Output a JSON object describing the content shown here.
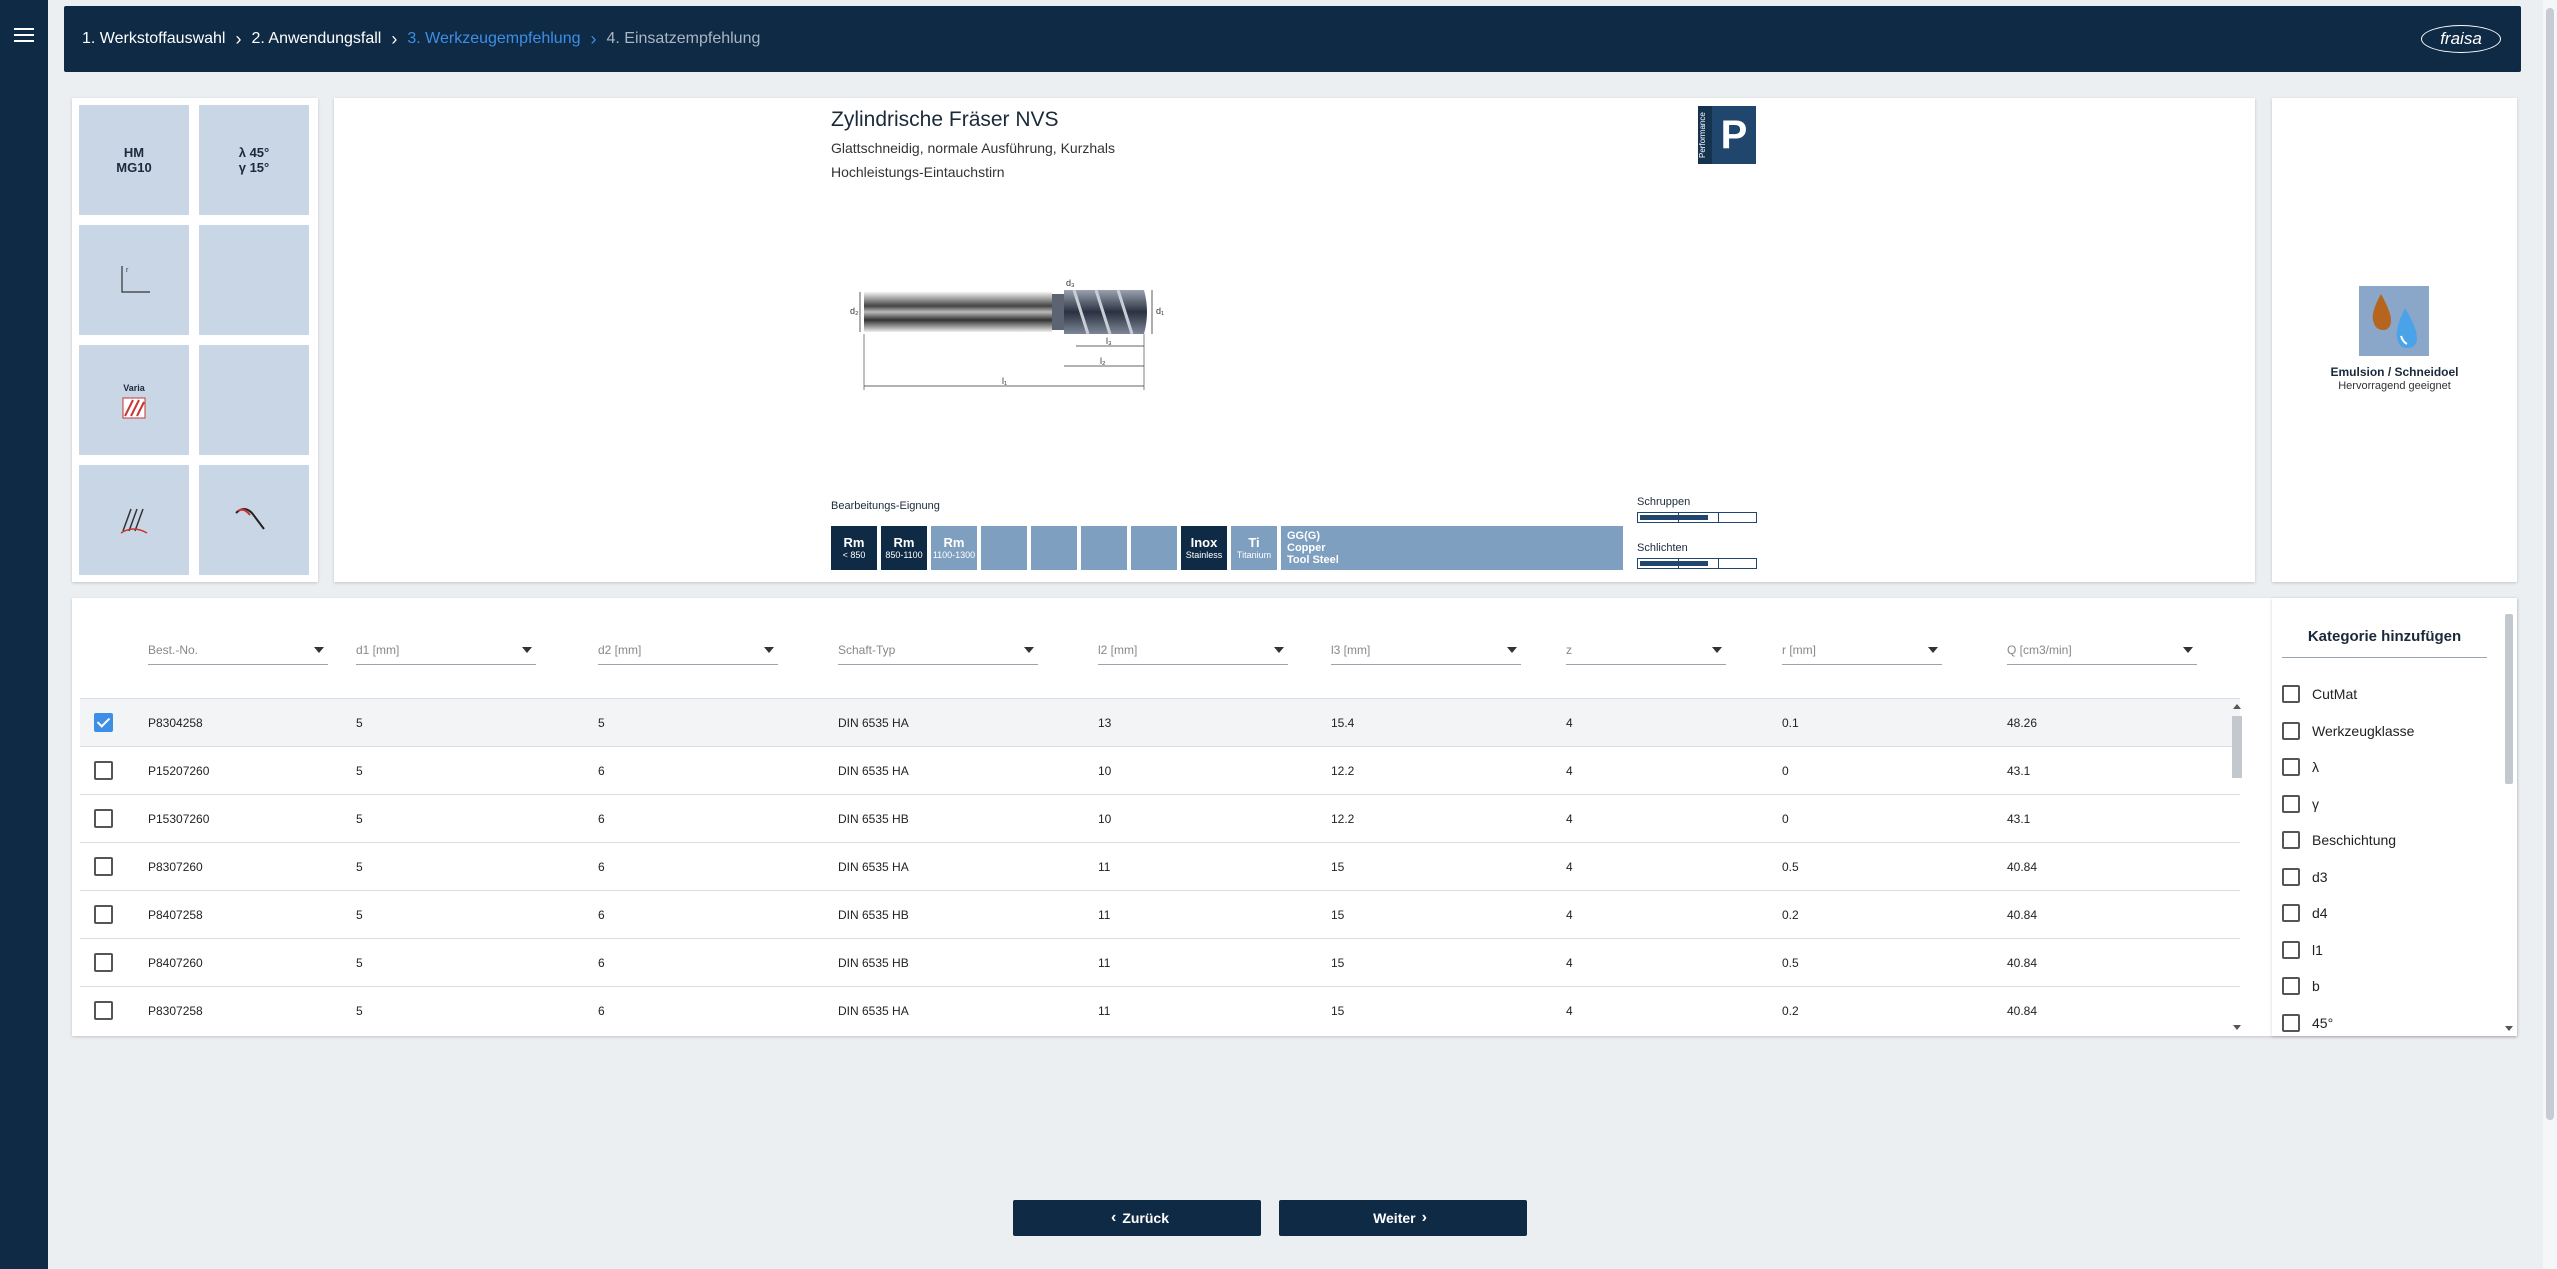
{
  "nav": {
    "steps": [
      {
        "label": "1. Werkstoffauswahl",
        "state": "done"
      },
      {
        "label": "2. Anwendungsfall",
        "state": "done"
      },
      {
        "label": "3. Werkzeugempfehlung",
        "state": "active"
      },
      {
        "label": "4. Einsatzempfehlung",
        "state": "pending"
      }
    ],
    "brand": "fraisa"
  },
  "tiles": {
    "material_line1": "HM",
    "material_line2": "MG10",
    "angle_lambda": "λ 45°",
    "angle_gamma": "γ 15°",
    "varia": "Varia"
  },
  "product": {
    "title": "Zylindrische Fräser NVS",
    "subtitle": "Glattschneidig, normale Ausführung, Kurzhals",
    "subtitle2": "Hochleistungs-Eintauchstirn",
    "badge_vertical": "Performance",
    "badge_letter": "P",
    "suitability_title": "Bearbeitungs-Eignung",
    "suitability": [
      {
        "big": "Rm",
        "small": "< 850",
        "style": "dark"
      },
      {
        "big": "Rm",
        "small": "850-1100",
        "style": "dark"
      },
      {
        "big": "Rm",
        "small": "1100-1300",
        "style": "light"
      },
      {
        "big": "",
        "small": "",
        "style": "light"
      },
      {
        "big": "",
        "small": "",
        "style": "light"
      },
      {
        "big": "",
        "small": "",
        "style": "light"
      },
      {
        "big": "",
        "small": "",
        "style": "light"
      },
      {
        "big": "Inox",
        "small": "Stainless",
        "style": "dark"
      },
      {
        "big": "Ti",
        "small": "Titanium",
        "style": "light"
      }
    ],
    "gg_lines": [
      "GG(G)",
      "Copper",
      "Tool Steel"
    ],
    "roughing_label": "Schruppen",
    "roughing_level": 0.6,
    "finishing_label": "Schlichten",
    "finishing_level": 0.6,
    "dim_labels": {
      "d2": "d₂",
      "d3": "d₃",
      "d1": "d₁",
      "l3": "l₃",
      "l2": "l₂",
      "l1": "l₁"
    }
  },
  "cooling": {
    "title": "Emulsion / Schneidoel",
    "subtitle": "Hervorragend geeignet"
  },
  "table": {
    "headers": [
      "Best.-No.",
      "d1 [mm]",
      "d2 [mm]",
      "Schaft-Typ",
      "l2 [mm]",
      "l3 [mm]",
      "z",
      "r [mm]",
      "Q [cm3/min]"
    ],
    "rows": [
      {
        "checked": true,
        "cells": [
          "P8304258",
          "5",
          "5",
          "DIN 6535 HA",
          "13",
          "15.4",
          "4",
          "0.1",
          "48.26"
        ]
      },
      {
        "checked": false,
        "cells": [
          "P15207260",
          "5",
          "6",
          "DIN 6535 HA",
          "10",
          "12.2",
          "4",
          "0",
          "43.1"
        ]
      },
      {
        "checked": false,
        "cells": [
          "P15307260",
          "5",
          "6",
          "DIN 6535 HB",
          "10",
          "12.2",
          "4",
          "0",
          "43.1"
        ]
      },
      {
        "checked": false,
        "cells": [
          "P8307260",
          "5",
          "6",
          "DIN 6535 HA",
          "11",
          "15",
          "4",
          "0.5",
          "40.84"
        ]
      },
      {
        "checked": false,
        "cells": [
          "P8407258",
          "5",
          "6",
          "DIN 6535 HB",
          "11",
          "15",
          "4",
          "0.2",
          "40.84"
        ]
      },
      {
        "checked": false,
        "cells": [
          "P8407260",
          "5",
          "6",
          "DIN 6535 HB",
          "11",
          "15",
          "4",
          "0.5",
          "40.84"
        ]
      },
      {
        "checked": false,
        "cells": [
          "P8307258",
          "5",
          "6",
          "DIN 6535 HA",
          "11",
          "15",
          "4",
          "0.2",
          "40.84"
        ]
      }
    ]
  },
  "categories": {
    "title": "Kategorie hinzufügen",
    "items": [
      "CutMat",
      "Werkzeugklasse",
      "λ",
      "γ",
      "Beschichtung",
      "d3",
      "d4",
      "l1",
      "b",
      "45°"
    ]
  },
  "footer": {
    "back_label": "Zurück",
    "next_label": "Weiter"
  },
  "colors": {
    "navy": "#0f2a45",
    "accent": "#3d8ee6",
    "tile": "#c8d6e6"
  }
}
